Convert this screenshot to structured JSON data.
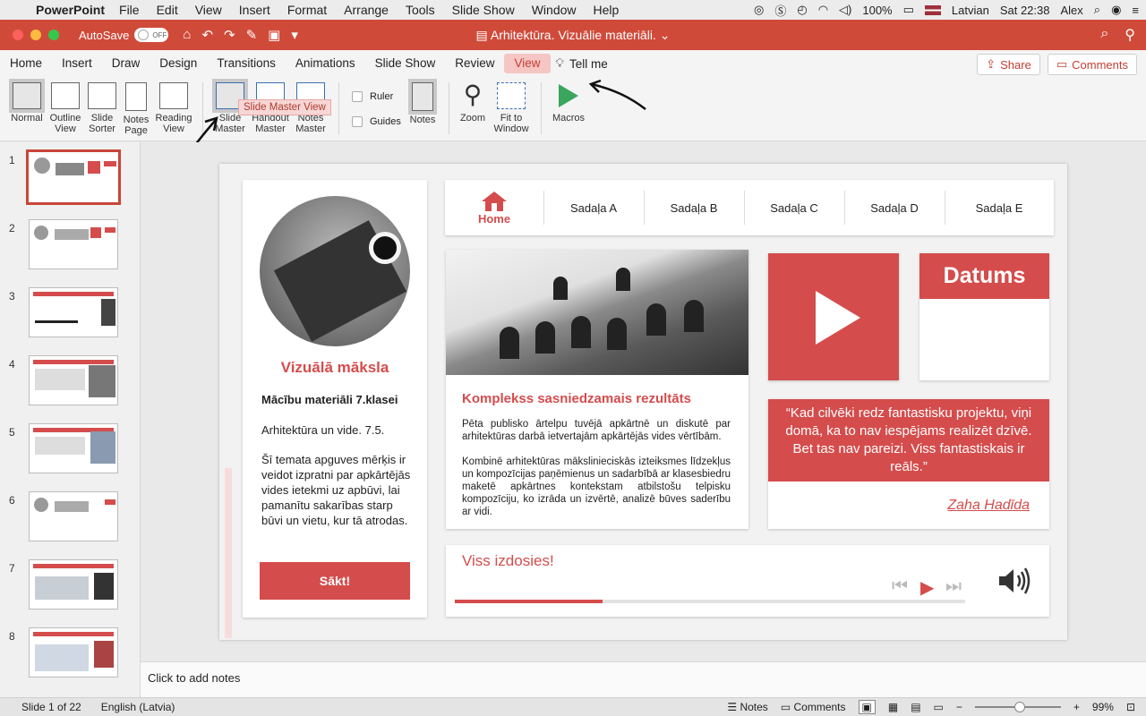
{
  "menubar": {
    "app": "PowerPoint",
    "items": [
      "File",
      "Edit",
      "View",
      "Insert",
      "Format",
      "Arrange",
      "Tools",
      "Slide Show",
      "Window",
      "Help"
    ],
    "battery": "100%",
    "input_source": "Latvian",
    "clock": "Sat 22:38",
    "user": "Alex"
  },
  "titlebar": {
    "autosave_label": "AutoSave",
    "autosave_state": "OFF",
    "document_title": "Arhitektūra. Vizuālie materiāli."
  },
  "tabs": {
    "items": [
      "Home",
      "Insert",
      "Draw",
      "Design",
      "Transitions",
      "Animations",
      "Slide Show",
      "Review",
      "View"
    ],
    "active": "View",
    "tell_me": "Tell me",
    "share": "Share",
    "comments": "Comments"
  },
  "ribbon": {
    "normal": "Normal",
    "outline_view": "Outline View",
    "slide_sorter": "Slide Sorter",
    "notes_page": "Notes Page",
    "reading_view": "Reading View",
    "slide_master": "Slide Master",
    "handout_master": "Handout Master",
    "notes_master": "Notes Master",
    "ruler": "Ruler",
    "guides": "Guides",
    "notes": "Notes",
    "zoom": "Zoom",
    "fit_to_window": "Fit to Window",
    "macros": "Macros",
    "tooltip": "Slide Master View"
  },
  "thumbnails": [
    "1",
    "2",
    "3",
    "4",
    "5",
    "6",
    "7",
    "8"
  ],
  "slide": {
    "left_panel": {
      "title": "Vizuālā māksla",
      "subtitle": "Mācību materiāli 7.klasei",
      "line": "Arhitektūra un vide. 7.5.",
      "paragraph": "Šī temata apguves mērķis ir veidot izpratni par apkārtējās vides ietekmi uz apbūvi, lai pamanītu sakarības starp būvi un vietu, kur tā atrodas.",
      "button": "Sākt!"
    },
    "nav": {
      "home": "Home",
      "items": [
        "Sadaļa A",
        "Sadaļa B",
        "Sadaļa C",
        "Sadaļa D",
        "Sadaļa E"
      ]
    },
    "result_card": {
      "title": "Komplekss sasniedzamais rezultāts",
      "text1": "Pēta publisko ārtelpu tuvējā apkārtnē un diskutē par arhitektūras darbā ietvertajām apkārtējās vides vērtībām.",
      "text2": "Kombinē arhitektūras mākslinieciskās izteiksmes līdzekļus un kompozīcijas paņēmienus un sadarbībā ar klasesbiedru maketē apkārtnes kontekstam atbilstošu telpisku kompozīciju, ko izrāda un izvērtē, analizē būves saderību ar vidi."
    },
    "date_card": {
      "title": "Datums"
    },
    "quote": {
      "text": "“Kad cilvēki redz fantastisku projektu, viņi domā, ka to nav iespējams realizēt dzīvē. Bet tas nav pareizi. Viss fantastiskais ir reāls.”",
      "author": "Zaha Hadīda"
    },
    "progress": {
      "title": "Viss izdosies!",
      "fraction": 0.29
    }
  },
  "notes_placeholder": "Click to add notes",
  "statusbar": {
    "slide_info": "Slide 1 of 22",
    "language": "English (Latvia)",
    "notes": "Notes",
    "comments": "Comments",
    "zoom": "99%"
  },
  "colors": {
    "accent": "#d54c4c",
    "titlebar": "#d04a3a"
  }
}
